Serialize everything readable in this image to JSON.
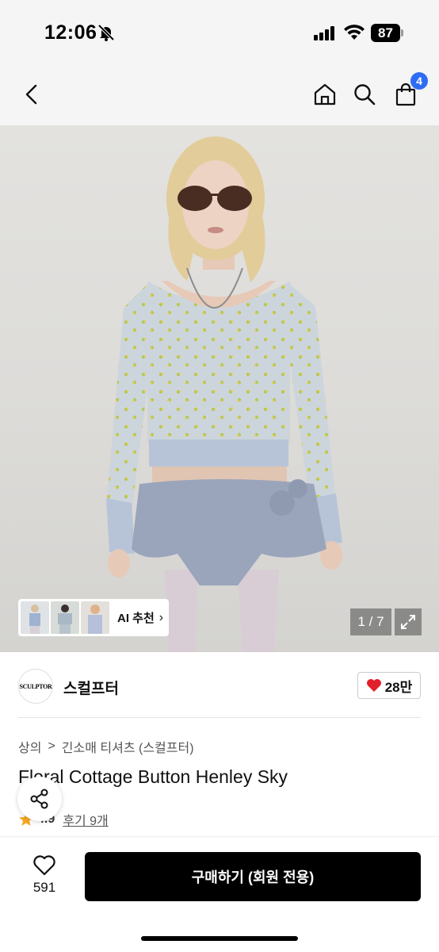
{
  "status_bar": {
    "time": "12:06",
    "battery": "87"
  },
  "nav": {
    "cart_count": "4"
  },
  "hero": {
    "ai_label": "AI 추천",
    "ai_chevron": "›",
    "counter": "1 / 7"
  },
  "brand": {
    "logo_text": "SCULPTOR",
    "name": "스컬프터",
    "likes": "28만"
  },
  "product": {
    "breadcrumb": [
      "상의",
      "긴소매 티셔츠 (스컬프터)"
    ],
    "breadcrumb_sep": ">",
    "title": "Floral Cottage Button Henley Sky",
    "rating": "4.9",
    "reviews": "후기 9개"
  },
  "bottom_bar": {
    "wish_count": "591",
    "buy_label": "구매하기 (회원 전용)"
  },
  "colors": {
    "accent_badge": "#2f6cf5",
    "heart_red": "#e0202a",
    "star": "#f5a623",
    "buy_button": "#000000"
  },
  "icons": [
    "back-icon",
    "home-icon",
    "search-icon",
    "cart-icon",
    "expand-icon",
    "heart-icon",
    "star-icon",
    "share-icon",
    "bell-off-icon",
    "signal-icon",
    "wifi-icon"
  ]
}
